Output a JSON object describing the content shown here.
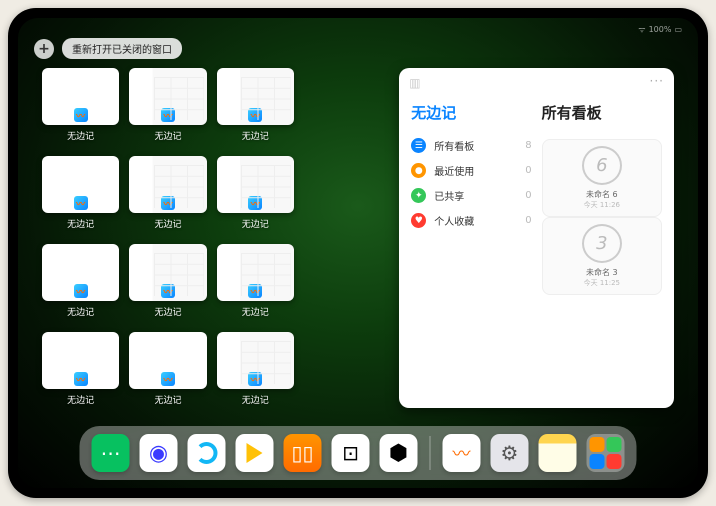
{
  "statusbar": {
    "wifi": "⋮⋮",
    "battery_text": "100%"
  },
  "topbar": {
    "plus_label": "+",
    "reopen_label": "重新打开已关闭的窗口"
  },
  "app_switcher": {
    "app_label": "无边记",
    "thumbs": [
      {
        "style": "blank"
      },
      {
        "style": "cal"
      },
      {
        "style": "cal"
      },
      null,
      {
        "style": "blank"
      },
      {
        "style": "cal"
      },
      {
        "style": "cal"
      },
      null,
      {
        "style": "blank"
      },
      {
        "style": "cal"
      },
      {
        "style": "cal"
      },
      null,
      {
        "style": "blank"
      },
      {
        "style": "blank"
      },
      {
        "style": "cal"
      },
      null
    ]
  },
  "panel": {
    "more": "···",
    "left_title": "无边记",
    "right_title": "所有看板",
    "sidebar": [
      {
        "icon_bg": "#0a84ff",
        "glyph": "☰",
        "label": "所有看板",
        "count": "8"
      },
      {
        "icon_bg": "#ff9500",
        "glyph": "●",
        "label": "最近使用",
        "count": "0"
      },
      {
        "icon_bg": "#34c759",
        "glyph": "✦",
        "label": "已共享",
        "count": "0"
      },
      {
        "icon_bg": "#ff3b30",
        "glyph": "♥",
        "label": "个人收藏",
        "count": "0"
      }
    ],
    "boards": [
      {
        "shape": "6",
        "name": "未命名 6",
        "sub": "今天 11:26"
      },
      {
        "shape": "3",
        "name": "未命名 3",
        "sub": "今天 11:25"
      }
    ]
  },
  "dock": {
    "apps": [
      {
        "name": "wechat",
        "cls": "di-wechat",
        "glyph": "⋯"
      },
      {
        "name": "moon",
        "cls": "di-moon",
        "glyph": "◉"
      },
      {
        "name": "qq",
        "cls": "di-qq",
        "glyph": ""
      },
      {
        "name": "play",
        "cls": "di-play",
        "glyph": ""
      },
      {
        "name": "books",
        "cls": "di-books",
        "glyph": "▯▯"
      },
      {
        "name": "square",
        "cls": "di-square",
        "glyph": "⊡"
      },
      {
        "name": "hex",
        "cls": "di-hex",
        "glyph": "⬢"
      }
    ],
    "recent": [
      {
        "name": "freeform",
        "cls": "di-freeform",
        "glyph": ""
      },
      {
        "name": "settings",
        "cls": "di-settings",
        "glyph": "⚙"
      },
      {
        "name": "notes",
        "cls": "di-notes",
        "glyph": ""
      }
    ]
  }
}
